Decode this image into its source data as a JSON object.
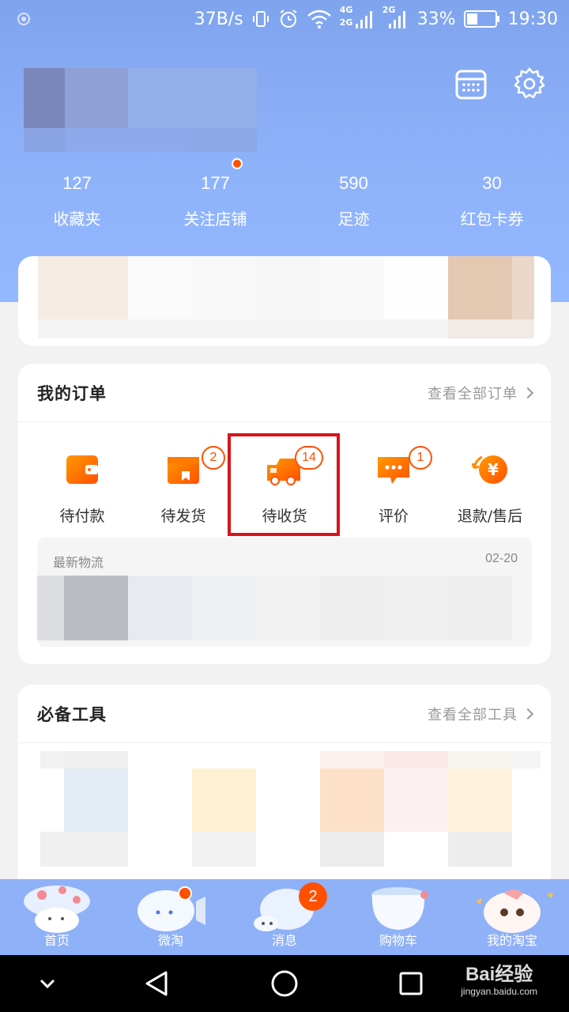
{
  "status_bar": {
    "speed": "37B/s",
    "net1": "4G",
    "net2": "2G",
    "net3": "2G",
    "battery": "33%",
    "time": "19:30"
  },
  "stats": [
    {
      "value": "127",
      "label": "收藏夹"
    },
    {
      "value": "177",
      "label": "关注店铺"
    },
    {
      "value": "590",
      "label": "足迹"
    },
    {
      "value": "30",
      "label": "红包卡券"
    }
  ],
  "orders": {
    "title": "我的订单",
    "view_all": "查看全部订单",
    "items": [
      {
        "label": "待付款",
        "icon": "wallet-icon"
      },
      {
        "label": "待发货",
        "icon": "package-icon",
        "badge": "2"
      },
      {
        "label": "待收货",
        "icon": "truck-icon",
        "badge": "14"
      },
      {
        "label": "评价",
        "icon": "comment-icon",
        "badge": "1"
      },
      {
        "label": "退款/售后",
        "icon": "refund-icon"
      }
    ],
    "logistics": {
      "title": "最新物流",
      "date": "02-20"
    }
  },
  "tools": {
    "title": "必备工具",
    "view_all": "查看全部工具"
  },
  "tabbar": {
    "tabs": [
      {
        "label": "首页"
      },
      {
        "label": "微淘"
      },
      {
        "label": "消息",
        "badge": "2"
      },
      {
        "label": "购物车"
      },
      {
        "label": "我的淘宝"
      }
    ]
  },
  "watermark": {
    "brand": "Bai经验",
    "url": "jingyan.baidu.com"
  },
  "colors": {
    "header": "#8fb3fb",
    "accent": "#ff5000",
    "highlight": "#d8141c"
  }
}
